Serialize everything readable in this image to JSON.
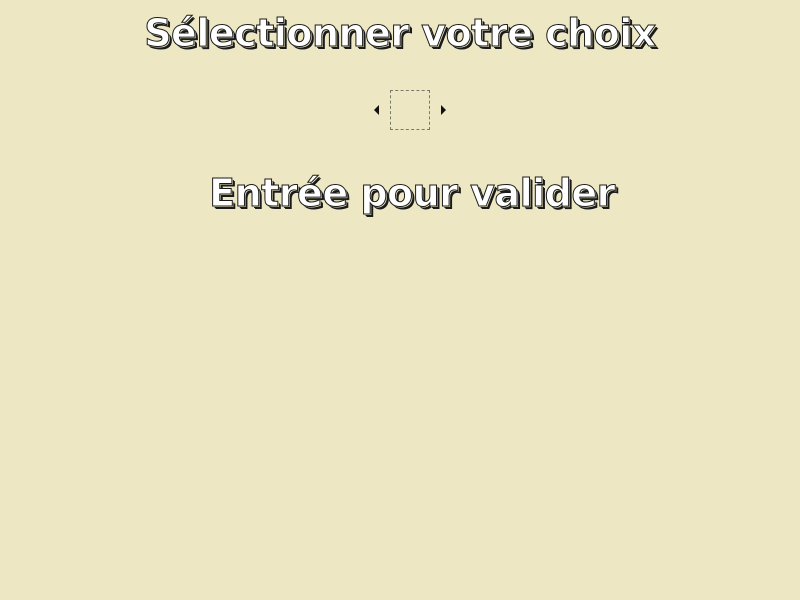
{
  "screen": {
    "title": "Sélectionner votre choix",
    "confirm_hint": "Entrée pour valider"
  },
  "selector": {
    "left_icon": "arrow-left-icon",
    "right_icon": "arrow-right-icon",
    "current_choice": ""
  },
  "colors": {
    "background": "#ede8c3",
    "ink": "#1a1a1a"
  }
}
